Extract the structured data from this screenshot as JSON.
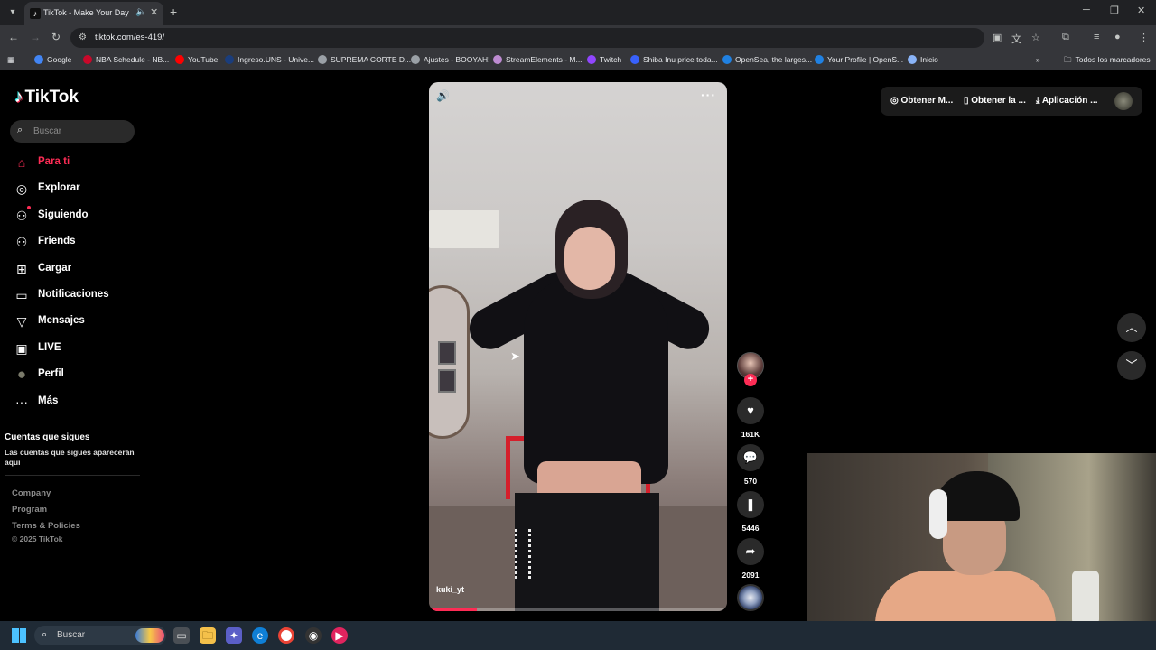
{
  "browser": {
    "tab_title": "TikTok - Make Your Day",
    "url": "tiktok.com/es-419/",
    "bookmarks": [
      {
        "label": "Google",
        "color": "#4285f4"
      },
      {
        "label": "NBA Schedule - NB...",
        "color": "#c9082a"
      },
      {
        "label": "YouTube",
        "color": "#ff0000"
      },
      {
        "label": "Ingreso.UNS - Unive...",
        "color": "#1a3d7c"
      },
      {
        "label": "SUPREMA CORTE D...",
        "color": "#9aa0a6"
      },
      {
        "label": "Ajustes - BOOYAH!",
        "color": "#9aa0a6"
      },
      {
        "label": "StreamElements - M...",
        "color": "#bd8bd1"
      },
      {
        "label": "Twitch",
        "color": "#9146ff"
      },
      {
        "label": "Shiba Inu price toda...",
        "color": "#3861fb"
      },
      {
        "label": "OpenSea, the larges...",
        "color": "#2081e2"
      },
      {
        "label": "Your Profile | OpenS...",
        "color": "#2081e2"
      },
      {
        "label": "Inicio",
        "color": "#8ab4f8"
      }
    ],
    "all_bookmarks": "Todos los marcadores"
  },
  "sidebar": {
    "logo": "TikTok",
    "search_placeholder": "Buscar",
    "nav": [
      {
        "label": "Para ti",
        "icon": "home-icon",
        "active": true
      },
      {
        "label": "Explorar",
        "icon": "compass-icon"
      },
      {
        "label": "Siguiendo",
        "icon": "following-icon"
      },
      {
        "label": "Friends",
        "icon": "friends-icon"
      },
      {
        "label": "Cargar",
        "icon": "upload-icon"
      },
      {
        "label": "Notificaciones",
        "icon": "notifications-icon"
      },
      {
        "label": "Mensajes",
        "icon": "messages-icon"
      },
      {
        "label": "LIVE",
        "icon": "live-icon"
      },
      {
        "label": "Perfil",
        "icon": "avatar"
      },
      {
        "label": "Más",
        "icon": "more-icon"
      }
    ],
    "following_heading": "Cuentas que sigues",
    "following_desc": "Las cuentas que sigues aparecerán aquí",
    "footer_links": [
      "Company",
      "Program",
      "Terms & Policies"
    ],
    "copyright": "© 2025 TikTok"
  },
  "video": {
    "username": "kuki_yt",
    "progress": 0.16,
    "likes": "161K",
    "comments": "570",
    "saves": "5446",
    "shares": "2091"
  },
  "topbar": {
    "coins": "Obtener M...",
    "app": "Obtener la ...",
    "desktop": "Aplicación ..."
  },
  "taskbar": {
    "search_placeholder": "Buscar"
  },
  "colors": {
    "accent": "#fe2c55",
    "background": "#000000"
  }
}
